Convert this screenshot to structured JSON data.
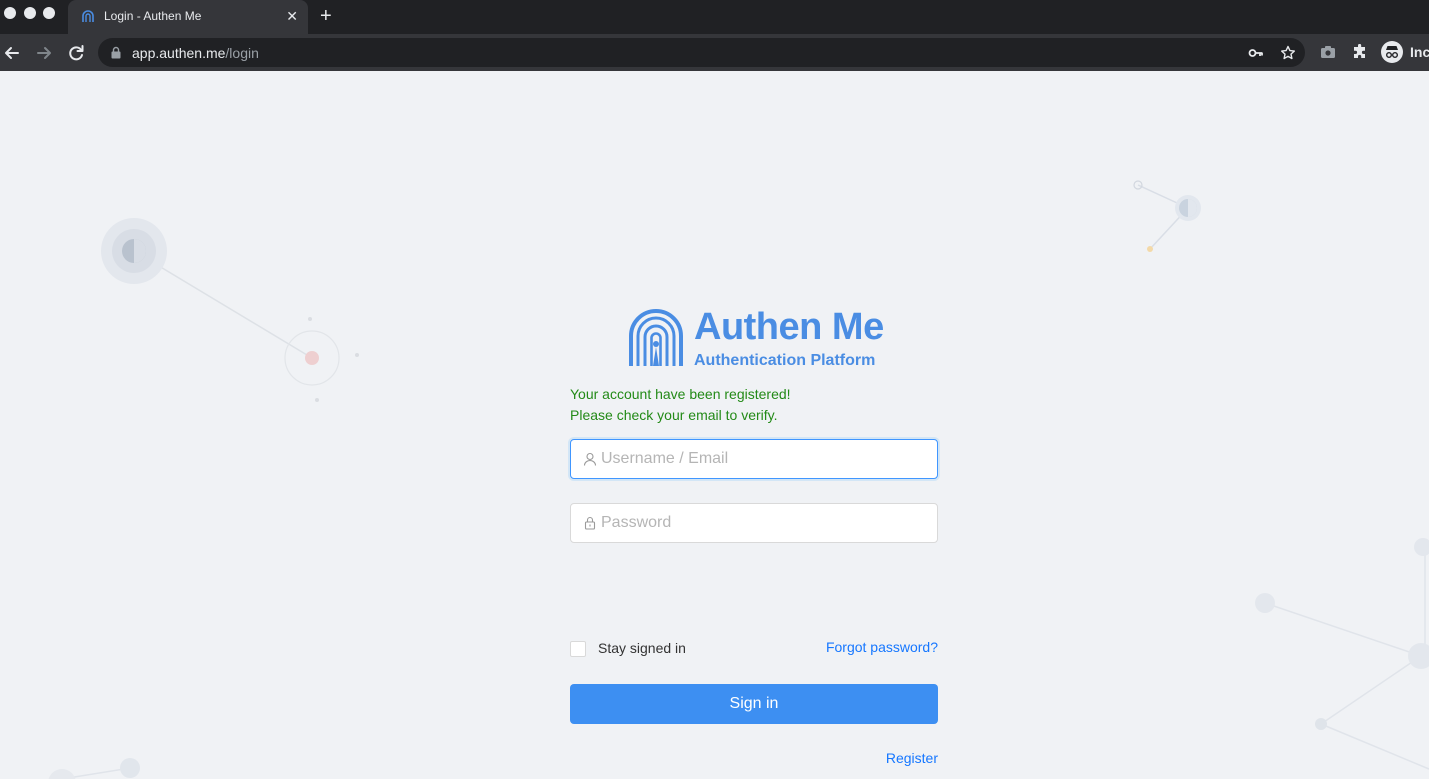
{
  "browser": {
    "tab": {
      "title": "Login - Authen Me",
      "close": "✕"
    },
    "new_tab": "+",
    "url": {
      "host": "app.authen.me",
      "path": "/login"
    },
    "profile_label": "Inc",
    "icons": [
      "back-icon",
      "forward-icon",
      "reload-icon",
      "lock-icon",
      "key-icon",
      "star-icon",
      "camera-icon",
      "extensions-icon",
      "incognito-icon"
    ]
  },
  "brand": {
    "name": "Authen Me",
    "tagline": "Authentication Platform",
    "color": "#4a8de3"
  },
  "alert": {
    "line1": "Your account have been registered!",
    "line2": "Please check your email to verify.",
    "color": "#238a17"
  },
  "form": {
    "username": {
      "placeholder": "Username / Email",
      "value": ""
    },
    "password": {
      "placeholder": "Password",
      "value": ""
    },
    "remember": {
      "label": "Stay signed in",
      "checked": false
    },
    "forgot_label": "Forgot password?",
    "submit_label": "Sign in",
    "register_label": "Register",
    "accent": "#3d8ff2"
  }
}
